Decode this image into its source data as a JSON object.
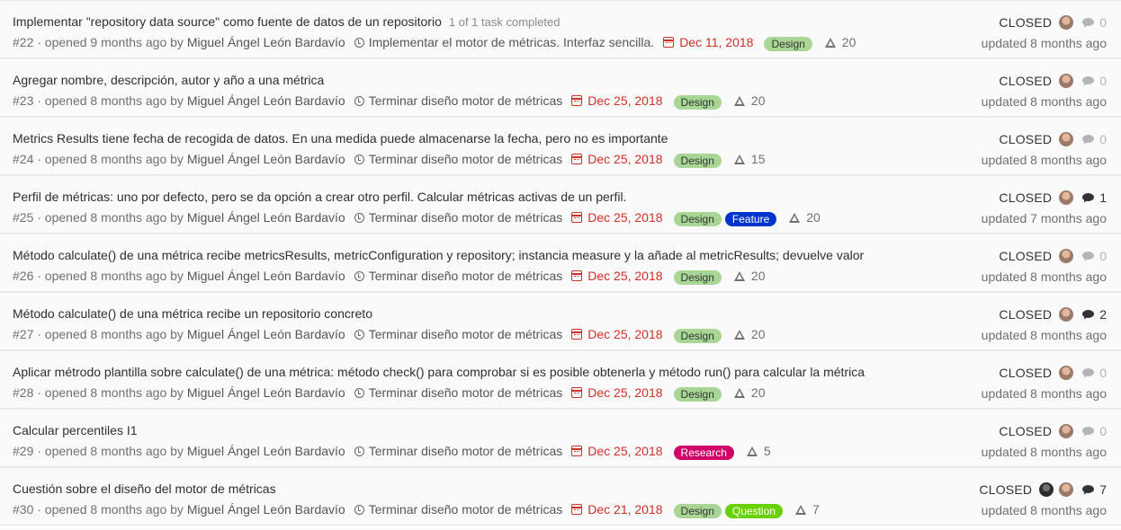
{
  "issues": [
    {
      "title": "Implementar \"repository data source\" como fuente de datos de un repositorio",
      "tasks": "1 of 1 task completed",
      "ref": "#22",
      "opened_text": " · opened 9 months ago by ",
      "author": "Miguel Ángel León Bardavío",
      "milestone": "Implementar el motor de métricas. Interfaz sencilla.",
      "due": "Dec 11, 2018",
      "labels": [
        {
          "text": "Design",
          "bg": "#a8d695",
          "fg": "#333333"
        }
      ],
      "weight": "20",
      "state": "CLOSED",
      "avatars": [
        "user-avatar"
      ],
      "comments": "0",
      "comments_active": false,
      "updated": "updated 8 months ago"
    },
    {
      "title": "Agregar nombre, descripción, autor y año a una métrica",
      "tasks": "",
      "ref": "#23",
      "opened_text": " · opened 8 months ago by ",
      "author": "Miguel Ángel León Bardavío",
      "milestone": "Terminar diseño motor de métricas",
      "due": "Dec 25, 2018",
      "labels": [
        {
          "text": "Design",
          "bg": "#a8d695",
          "fg": "#333333"
        }
      ],
      "weight": "20",
      "state": "CLOSED",
      "avatars": [
        "user-avatar"
      ],
      "comments": "0",
      "comments_active": false,
      "updated": "updated 8 months ago"
    },
    {
      "title": "Metrics Results tiene fecha de recogida de datos. En una medida puede almacenarse la fecha, pero no es importante",
      "tasks": "",
      "ref": "#24",
      "opened_text": " · opened 8 months ago by ",
      "author": "Miguel Ángel León Bardavío",
      "milestone": "Terminar diseño motor de métricas",
      "due": "Dec 25, 2018",
      "labels": [
        {
          "text": "Design",
          "bg": "#a8d695",
          "fg": "#333333"
        }
      ],
      "weight": "15",
      "state": "CLOSED",
      "avatars": [
        "user-avatar"
      ],
      "comments": "0",
      "comments_active": false,
      "updated": "updated 8 months ago"
    },
    {
      "title": "Perfil de métricas: uno por defecto, pero se da opción a crear otro perfil. Calcular métricas activas de un perfil.",
      "tasks": "",
      "ref": "#25",
      "opened_text": " · opened 8 months ago by ",
      "author": "Miguel Ángel León Bardavío",
      "milestone": "Terminar diseño motor de métricas",
      "due": "Dec 25, 2018",
      "labels": [
        {
          "text": "Design",
          "bg": "#a8d695",
          "fg": "#333333"
        },
        {
          "text": "Feature",
          "bg": "#0033cc",
          "fg": "#ffffff"
        }
      ],
      "weight": "20",
      "state": "CLOSED",
      "avatars": [
        "user-avatar"
      ],
      "comments": "1",
      "comments_active": true,
      "updated": "updated 7 months ago"
    },
    {
      "title": "Método calculate() de una métrica recibe metricsResults, metricConfiguration y repository; instancia measure y la añade al metricResults; devuelve valor",
      "tasks": "",
      "ref": "#26",
      "opened_text": " · opened 8 months ago by ",
      "author": "Miguel Ángel León Bardavío",
      "milestone": "Terminar diseño motor de métricas",
      "due": "Dec 25, 2018",
      "labels": [
        {
          "text": "Design",
          "bg": "#a8d695",
          "fg": "#333333"
        }
      ],
      "weight": "20",
      "state": "CLOSED",
      "avatars": [
        "user-avatar"
      ],
      "comments": "0",
      "comments_active": false,
      "updated": "updated 8 months ago"
    },
    {
      "title": "Método calculate() de una métrica recibe un repositorio concreto",
      "tasks": "",
      "ref": "#27",
      "opened_text": " · opened 8 months ago by ",
      "author": "Miguel Ángel León Bardavío",
      "milestone": "Terminar diseño motor de métricas",
      "due": "Dec 25, 2018",
      "labels": [
        {
          "text": "Design",
          "bg": "#a8d695",
          "fg": "#333333"
        }
      ],
      "weight": "20",
      "state": "CLOSED",
      "avatars": [
        "user-avatar"
      ],
      "comments": "2",
      "comments_active": true,
      "updated": "updated 8 months ago"
    },
    {
      "title": "Aplicar métrodo plantilla sobre calculate() de una métrica: método check() para comprobar si es posible obtenerla y método run() para calcular la métrica",
      "tasks": "",
      "ref": "#28",
      "opened_text": " · opened 8 months ago by ",
      "author": "Miguel Ángel León Bardavío",
      "milestone": "Terminar diseño motor de métricas",
      "due": "Dec 25, 2018",
      "labels": [
        {
          "text": "Design",
          "bg": "#a8d695",
          "fg": "#333333"
        }
      ],
      "weight": "20",
      "state": "CLOSED",
      "avatars": [
        "user-avatar"
      ],
      "comments": "0",
      "comments_active": false,
      "updated": "updated 8 months ago"
    },
    {
      "title": "Calcular percentiles I1",
      "tasks": "",
      "ref": "#29",
      "opened_text": " · opened 8 months ago by ",
      "author": "Miguel Ángel León Bardavío",
      "milestone": "Terminar diseño motor de métricas",
      "due": "Dec 25, 2018",
      "labels": [
        {
          "text": "Research",
          "bg": "#d10069",
          "fg": "#ffffff"
        }
      ],
      "weight": "5",
      "state": "CLOSED",
      "avatars": [
        "user-avatar"
      ],
      "comments": "0",
      "comments_active": false,
      "updated": "updated 8 months ago"
    },
    {
      "title": "Cuestión sobre el diseño del motor de métricas",
      "tasks": "",
      "ref": "#30",
      "opened_text": " · opened 8 months ago by ",
      "author": "Miguel Ángel León Bardavío",
      "milestone": "Terminar diseño motor de métricas",
      "due": "Dec 21, 2018",
      "labels": [
        {
          "text": "Design",
          "bg": "#a8d695",
          "fg": "#333333"
        },
        {
          "text": "Question",
          "bg": "#69d100",
          "fg": "#ffffff"
        }
      ],
      "weight": "7",
      "state": "CLOSED",
      "avatars": [
        "user-avatar-dark",
        "user-avatar"
      ],
      "comments": "7",
      "comments_active": true,
      "updated": "updated 8 months ago"
    }
  ]
}
